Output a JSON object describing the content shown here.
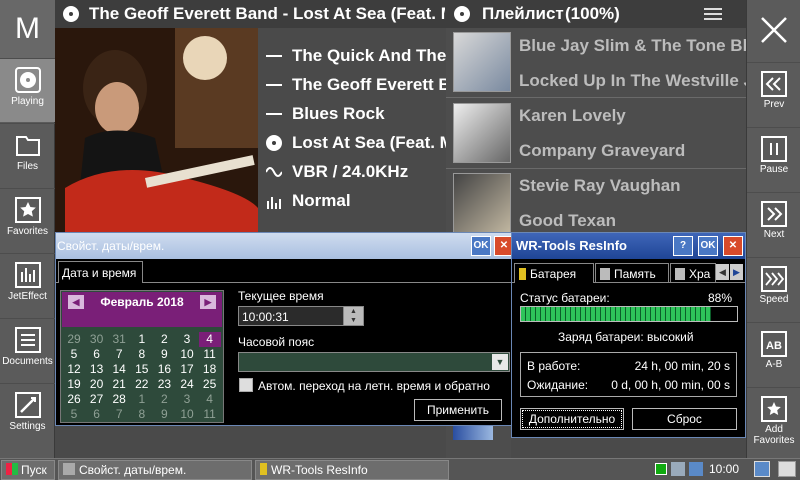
{
  "app": {
    "logo": "M"
  },
  "left_nav": [
    {
      "label": "Playing",
      "icon": "disc-icon"
    },
    {
      "label": "Files",
      "icon": "folder-icon"
    },
    {
      "label": "Favorites",
      "icon": "star-icon"
    },
    {
      "label": "JetEffect",
      "icon": "equalizer-icon"
    },
    {
      "label": "Documents",
      "icon": "document-icon"
    },
    {
      "label": "Settings",
      "icon": "wrench-icon"
    }
  ],
  "right_nav": [
    {
      "label": "Prev",
      "icon": "prev-icon"
    },
    {
      "label": "Pause",
      "icon": "pause-icon"
    },
    {
      "label": "Next",
      "icon": "next-icon"
    },
    {
      "label": "Speed",
      "icon": "speed-icon"
    },
    {
      "label": "A-B",
      "icon": "ab-icon"
    },
    {
      "label": "Add Favorites",
      "icon": "add-favorite-icon"
    }
  ],
  "now_playing": {
    "title": "The Geoff Everett Band - Lost At Sea (Feat. Mollie Ma",
    "rows": [
      "The Quick And The ...",
      "The Geoff Everett B...",
      "Blues Rock",
      "Lost At Sea (Feat. M...",
      "VBR / 24.0KHz",
      "Normal"
    ]
  },
  "playlist": {
    "label": "Плейлист",
    "percent": "(100%)",
    "items": [
      {
        "artist": "Blue Jay Slim & The Tone Blasters",
        "title": "Locked Up In The Westville Jail"
      },
      {
        "artist": "Karen Lovely",
        "title": "Company Graveyard"
      },
      {
        "artist": "Stevie Ray Vaughan",
        "title": "Good Texan"
      }
    ]
  },
  "datetime_dialog": {
    "title": "Свойст. даты/врем.",
    "ok": "OK",
    "close": "✕",
    "tab": "Дата и время",
    "month": "Февраль 2018",
    "weeks": [
      [
        "29",
        "30",
        "31",
        "1",
        "2",
        "3",
        "4"
      ],
      [
        "5",
        "6",
        "7",
        "8",
        "9",
        "10",
        "11"
      ],
      [
        "12",
        "13",
        "14",
        "15",
        "16",
        "17",
        "18"
      ],
      [
        "19",
        "20",
        "21",
        "22",
        "23",
        "24",
        "25"
      ],
      [
        "26",
        "27",
        "28",
        "1",
        "2",
        "3",
        "4"
      ],
      [
        "5",
        "6",
        "7",
        "8",
        "9",
        "10",
        "11"
      ]
    ],
    "current_time_label": "Текущее время",
    "time": "10:00:31",
    "timezone_label": "Часовой пояс",
    "timezone_value": "",
    "dst_label": "Автом. переход на летн. время и обратно",
    "apply": "Применить"
  },
  "wr_tools": {
    "title": "WR-Tools ResInfo",
    "help": "?",
    "ok": "OK",
    "close": "✕",
    "tabs": [
      "Батарея",
      "Память",
      "Хра"
    ],
    "status_label": "Статус батареи:",
    "status_value": "88%",
    "battery_level": 0.88,
    "charge_text": "Заряд батареи: высокий",
    "working_label": "В работе:",
    "working_value": "24 h, 00 min, 20 s",
    "standby_label": "Ожидание:",
    "standby_value": "0 d, 00 h, 00 min, 00 s",
    "more_button": "Дополнительно",
    "reset_button": "Сброс"
  },
  "taskbar": {
    "start": "Пуск",
    "task1": "Свойст. даты/врем.",
    "task2": "WR-Tools ResInfo",
    "clock": "10:00"
  }
}
